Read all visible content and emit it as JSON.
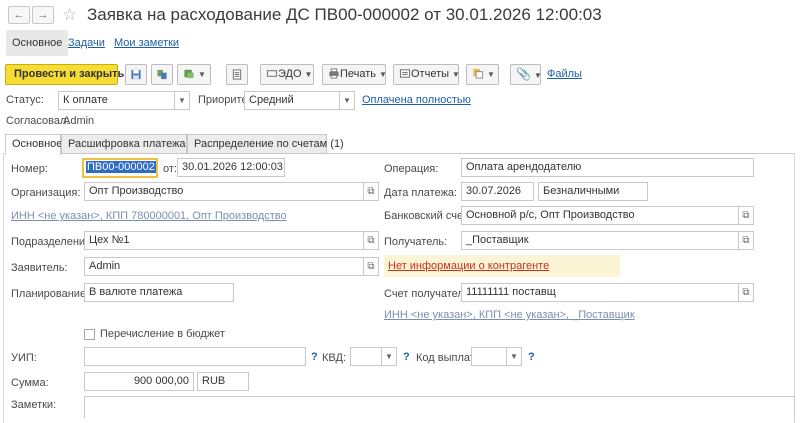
{
  "window": {
    "title": "Заявка на расходование ДС ПВ00-000002 от 30.01.2026 12:00:03"
  },
  "nav_tabs": [
    {
      "label": "Основное"
    },
    {
      "label": "Задачи"
    },
    {
      "label": "Мои заметки"
    }
  ],
  "toolbar": {
    "post_close_label": "Провести и закрыть",
    "edo_label": "ЭДО",
    "print_label": "Печать",
    "reports_label": "Отчеты",
    "files_label": "Файлы"
  },
  "header": {
    "status_label": "Статус:",
    "status_value": "К оплате",
    "priority_label": "Приоритет:",
    "priority_value": "Средний",
    "paid_link": "Оплачена полностью",
    "approved_label": "Согласовал:",
    "approved_value": "Admin"
  },
  "form_tabs": [
    {
      "label": "Основное"
    },
    {
      "label": "Расшифровка платежа (1)"
    },
    {
      "label": "Распределение по счетам (1)"
    }
  ],
  "form": {
    "number_label": "Номер:",
    "number_value": "ПВ00-000002",
    "from_label": "от:",
    "date_value": "30.01.2026 12:00:03",
    "organization_label": "Организация:",
    "organization_value": "Опт Производство",
    "org_inn_link": "ИНН <не указан>, КПП 780000001, Опт Производство",
    "department_label": "Подразделение:",
    "department_value": "Цех №1",
    "applicant_label": "Заявитель:",
    "applicant_value": "Admin",
    "planning_label": "Планирование:",
    "planning_value": "В валюте платежа",
    "operation_label": "Операция:",
    "operation_value": "Оплата арендодателю",
    "payment_date_label": "Дата платежа:",
    "payment_date_value": "30.07.2026",
    "payment_form_value": "Безналичными",
    "bank_account_label": "Банковский счет:",
    "bank_account_value": "Основной р/с, Опт Производство",
    "recipient_label": "Получатель:",
    "recipient_value": "_Поставщик",
    "no_info_warning": "Нет информации о контрагенте",
    "recipient_account_label": "Счет получателя:",
    "recipient_account_value": "11111111 поставщ",
    "recipient_inn_link": "ИНН <не указан>, КПП <не указан>, _Поставщик",
    "budget_transfer_label": "Перечисление в бюджет",
    "uip_label": "УИП:",
    "q_mark": "?",
    "kbd_label": "КВД:",
    "payment_code_label": "Код выплат:",
    "amount_label": "Сумма:",
    "amount_value": "900 000,00",
    "currency_value": "RUB",
    "notes_label": "Заметки:"
  },
  "colors": {
    "primary_button": "#f6dc33",
    "link": "#1c5ea8",
    "warning_text": "#c8311e",
    "warning_bg": "#fbf5d6",
    "focus_border": "#f0c23c"
  },
  "icons": {
    "back": "left-arrow-icon",
    "forward": "right-arrow-icon",
    "favorite": "star-icon",
    "save": "floppy-disk-icon",
    "structure": "document-structure-icon",
    "create_based": "create-based-on-icon",
    "list": "document-list-icon",
    "attach": "paperclip-icon"
  }
}
